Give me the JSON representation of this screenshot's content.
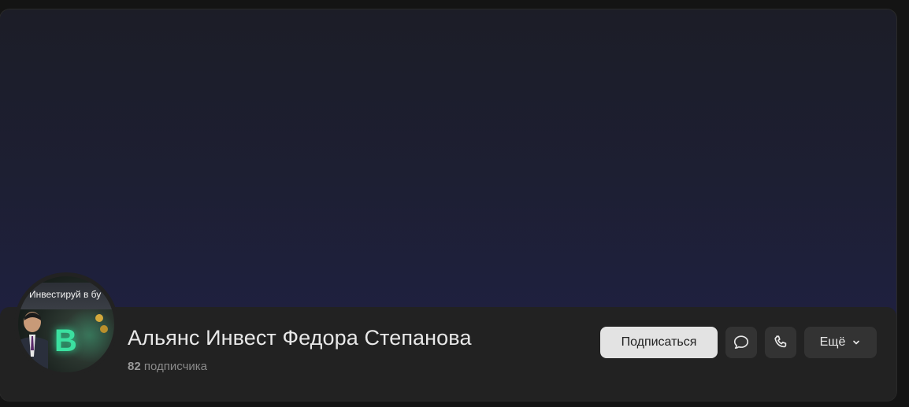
{
  "community": {
    "name": "Альянс Инвест Федора Степанова",
    "subscribers_count": "82",
    "subscribers_label": "подписчика"
  },
  "avatar": {
    "text": "Инвестируй в бу",
    "glyph": "B"
  },
  "actions": {
    "subscribe_label": "Подписаться",
    "message_icon": "chat-bubble-icon",
    "call_icon": "phone-icon",
    "more_label": "Ещё",
    "more_icon": "chevron-down-icon"
  }
}
